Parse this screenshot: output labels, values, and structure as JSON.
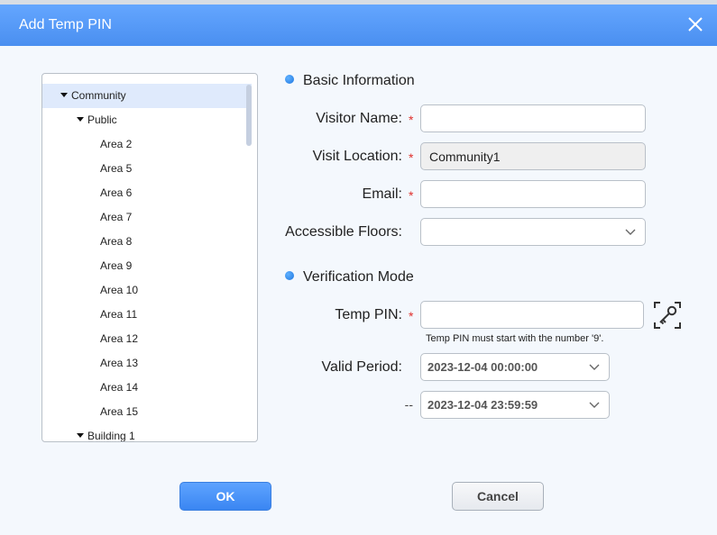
{
  "dialog": {
    "title": "Add Temp PIN"
  },
  "tree": {
    "items": [
      {
        "label": "Community",
        "level": 0,
        "expanded": true,
        "selected": true
      },
      {
        "label": "Public",
        "level": 1,
        "expanded": true
      },
      {
        "label": "Area 2",
        "level": 2
      },
      {
        "label": "Area 5",
        "level": 2
      },
      {
        "label": "Area 6",
        "level": 2
      },
      {
        "label": "Area 7",
        "level": 2
      },
      {
        "label": "Area 8",
        "level": 2
      },
      {
        "label": "Area 9",
        "level": 2
      },
      {
        "label": "Area 10",
        "level": 2
      },
      {
        "label": "Area 11",
        "level": 2
      },
      {
        "label": "Area 12",
        "level": 2
      },
      {
        "label": "Area 13",
        "level": 2
      },
      {
        "label": "Area 14",
        "level": 2
      },
      {
        "label": "Area 15",
        "level": 2
      },
      {
        "label": "Building 1",
        "level": 1,
        "expanded": true
      }
    ]
  },
  "basic": {
    "heading": "Basic Information",
    "visitor_name_label": "Visitor Name:",
    "visitor_name_value": "",
    "visit_location_label": "Visit Location:",
    "visit_location_value": "Community1",
    "email_label": "Email:",
    "email_value": "",
    "floors_label": "Accessible Floors:",
    "floors_value": ""
  },
  "verification": {
    "heading": "Verification Mode",
    "temp_pin_label": "Temp PIN:",
    "temp_pin_value": "",
    "temp_pin_hint": "Temp PIN must start with the number '9'.",
    "valid_period_label": "Valid Period:",
    "start": "2023-12-04 00:00:00",
    "separator": "--",
    "end": "2023-12-04 23:59:59"
  },
  "required_mark": "*",
  "buttons": {
    "ok": "OK",
    "cancel": "Cancel"
  },
  "icons": {
    "close": "close-icon",
    "key": "key-icon",
    "chevron": "chevron-down-icon"
  }
}
